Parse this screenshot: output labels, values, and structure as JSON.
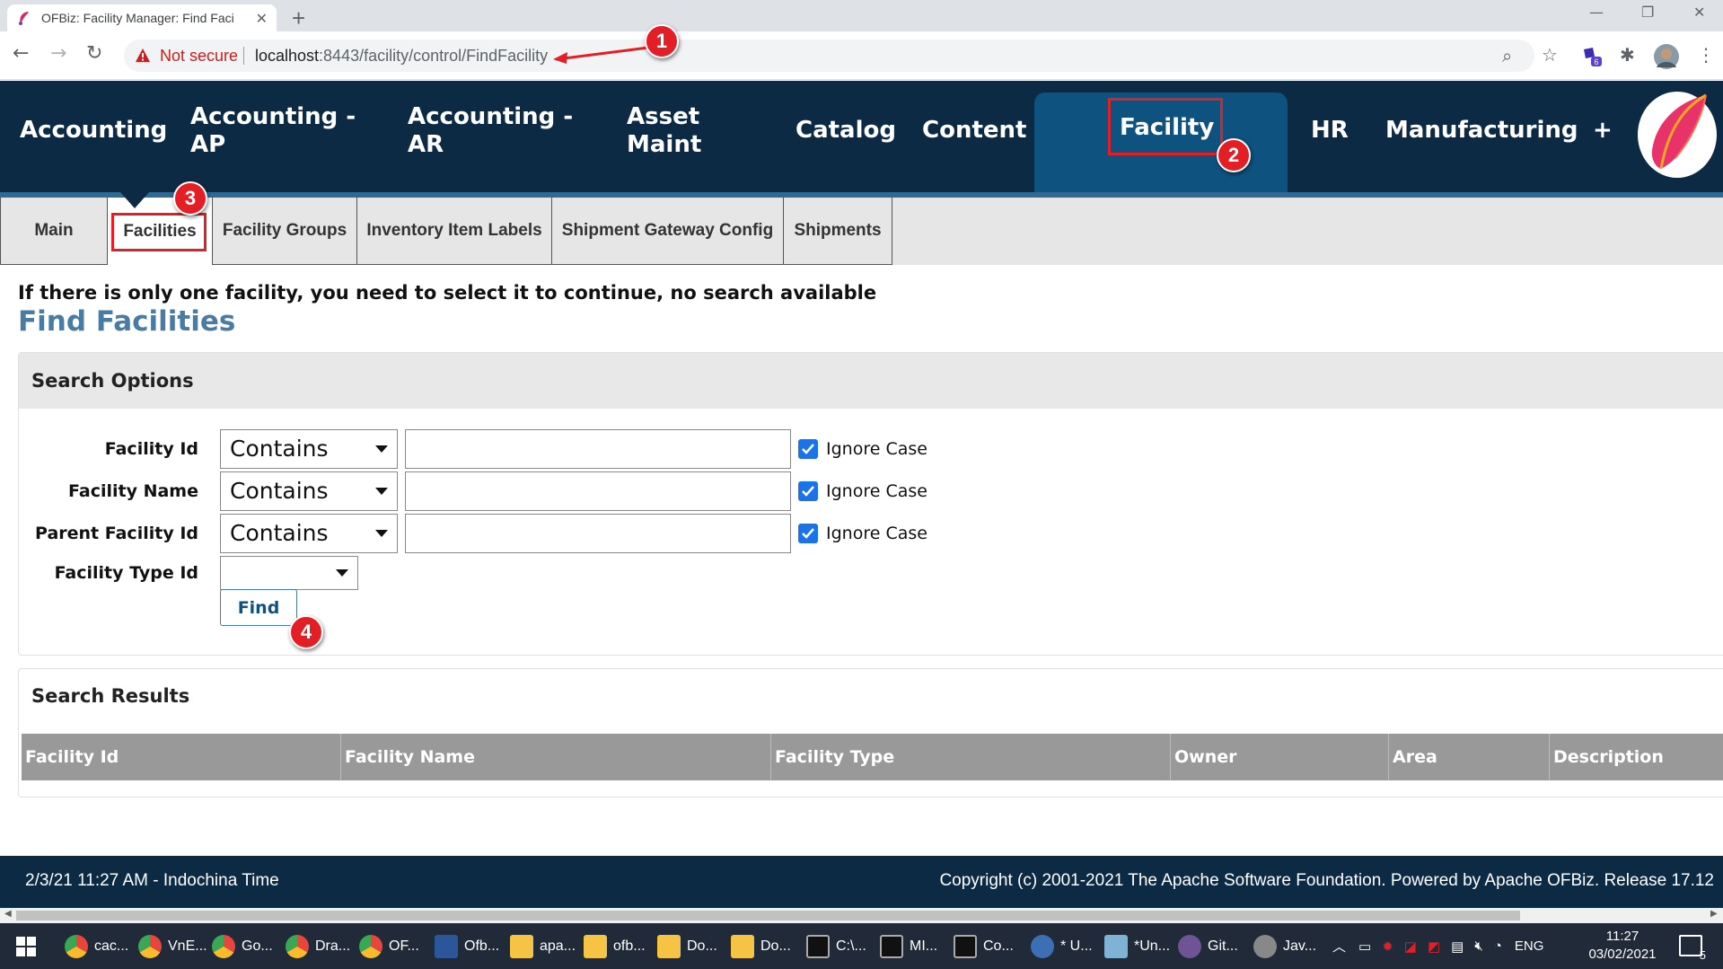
{
  "browser": {
    "tab_title": "OFBiz: Facility Manager: Find Faci",
    "not_secure": "Not secure",
    "url_host": "localhost",
    "url_rest": ":8443/facility/control/FindFacility",
    "extension_badge": "6"
  },
  "app_nav": {
    "items": [
      {
        "label": "Accounting"
      },
      {
        "label": "Accounting -\nAP"
      },
      {
        "label": "Accounting -\nAR"
      },
      {
        "label": "Asset\nMaint"
      },
      {
        "label": "Catalog"
      },
      {
        "label": "Content"
      },
      {
        "label": "Facility",
        "active": true
      },
      {
        "label": "HR"
      },
      {
        "label": "Manufacturing"
      },
      {
        "label": "+"
      }
    ]
  },
  "sub_nav": {
    "tabs": [
      {
        "label": "Main"
      },
      {
        "label": "Facilities",
        "active": true
      },
      {
        "label": "Facility Groups"
      },
      {
        "label": "Inventory Item Labels"
      },
      {
        "label": "Shipment Gateway Config"
      },
      {
        "label": "Shipments"
      }
    ]
  },
  "content": {
    "notice": "If there is only one facility, you need to select it to continue, no search available",
    "title": "Find Facilities"
  },
  "search_options": {
    "heading": "Search Options",
    "fields": [
      {
        "label": "Facility Id",
        "operator": "Contains",
        "value": "",
        "ignore_case_label": "Ignore Case",
        "ignore_case": true
      },
      {
        "label": "Facility Name",
        "operator": "Contains",
        "value": "",
        "ignore_case_label": "Ignore Case",
        "ignore_case": true
      },
      {
        "label": "Parent Facility Id",
        "operator": "Contains",
        "value": "",
        "ignore_case_label": "Ignore Case",
        "ignore_case": true
      }
    ],
    "type_field": {
      "label": "Facility Type Id",
      "value": ""
    },
    "find_button": "Find"
  },
  "search_results": {
    "heading": "Search Results",
    "columns": [
      "Facility Id",
      "Facility Name",
      "Facility Type",
      "Owner",
      "Area",
      "Description"
    ],
    "rows": []
  },
  "footer": {
    "left": "2/3/21 11:27 AM - Indochina Time",
    "right": "Copyright (c) 2001-2021 The Apache Software Foundation. Powered by Apache OFBiz. Release 17.12"
  },
  "taskbar": {
    "items": [
      {
        "label": "cac...",
        "icon": "chrome-icon",
        "color": "#e8453c"
      },
      {
        "label": "VnE...",
        "icon": "chrome-icon",
        "color": "#e8453c"
      },
      {
        "label": "Go...",
        "icon": "chrome-icon",
        "color": "#e8453c"
      },
      {
        "label": "Dra...",
        "icon": "chrome-icon",
        "color": "#e8453c"
      },
      {
        "label": "OF...",
        "icon": "chrome-icon",
        "color": "#e8453c"
      },
      {
        "label": "Ofb...",
        "icon": "word-icon",
        "color": "#2b579a"
      },
      {
        "label": "apa...",
        "icon": "folder-icon",
        "color": "#f6c445"
      },
      {
        "label": "ofb...",
        "icon": "folder-icon",
        "color": "#f6c445"
      },
      {
        "label": "Do...",
        "icon": "folder-icon",
        "color": "#f6c445"
      },
      {
        "label": "Do...",
        "icon": "folder-icon",
        "color": "#f6c445"
      },
      {
        "label": "C:\\...",
        "icon": "terminal-icon",
        "color": "#111111"
      },
      {
        "label": "MI...",
        "icon": "terminal-icon",
        "color": "#111111"
      },
      {
        "label": "Co...",
        "icon": "terminal-icon",
        "color": "#111111"
      },
      {
        "label": "* U...",
        "icon": "eclipse-icon",
        "color": "#3d6fb4"
      },
      {
        "label": "*Un...",
        "icon": "notepad-icon",
        "color": "#7fb3d5"
      },
      {
        "label": "Git...",
        "icon": "github-icon",
        "color": "#6e5494"
      },
      {
        "label": "Jav...",
        "icon": "gear-icon",
        "color": "#888888"
      }
    ],
    "tray": {
      "language": "ENG",
      "time": "11:27",
      "date": "03/02/2021",
      "notifications": "5"
    }
  },
  "annotations": [
    {
      "number": "1"
    },
    {
      "number": "2"
    },
    {
      "number": "3"
    },
    {
      "number": "4"
    }
  ],
  "colors": {
    "app_bar": "#0d2a44",
    "active_tab": "#0e5280",
    "title_blue": "#4a7ba3",
    "annotation_red": "#e31e24",
    "checkbox_blue": "#1a73e8"
  }
}
